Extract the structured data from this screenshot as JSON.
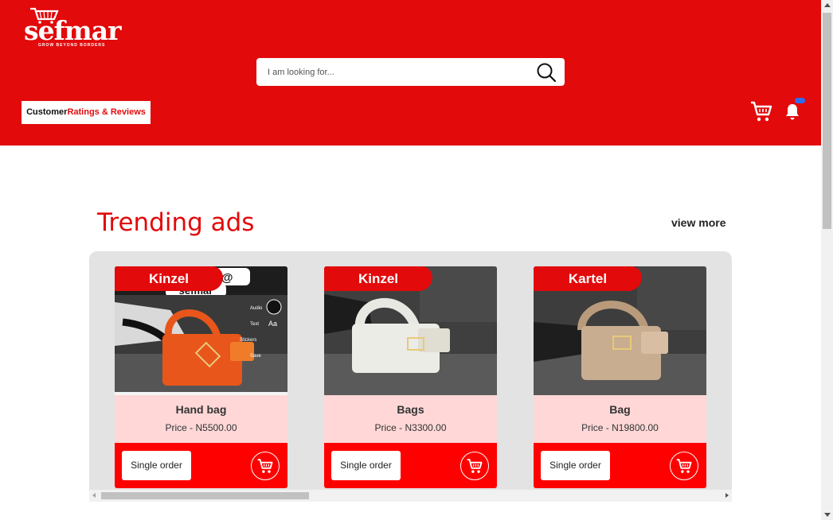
{
  "brand": {
    "name": "sefmar",
    "tagline": "GROW BEYOND BORDERS"
  },
  "search": {
    "placeholder": "I am looking for..."
  },
  "nav": {
    "reviews_part1": "Customer",
    "reviews_part2": "Ratings & Reviews"
  },
  "icons": {
    "cart": "cart-icon",
    "bell": "bell-icon",
    "search": "search-icon"
  },
  "colors": {
    "brand_red": "#e20a0b",
    "card_bg": "#ffd7d7",
    "card_footer": "#ff0000",
    "badge": "#2f6df6"
  },
  "trending": {
    "title": "Trending ads",
    "view_more": "view more",
    "items": [
      {
        "seller": "Kinzel",
        "name": "Hand bag",
        "price": "Price - N5500.00",
        "order_label": "Single order",
        "bag_color": "#e8561b"
      },
      {
        "seller": "Kinzel",
        "name": "Bags",
        "price": "Price - N3300.00",
        "order_label": "Single order",
        "bag_color": "#ecece6"
      },
      {
        "seller": "Kartel",
        "name": "Bag",
        "price": "Price - N19800.00",
        "order_label": "Single order",
        "bag_color": "#c9ad90"
      }
    ]
  },
  "story_overlay": {
    "text": "s @",
    "text2": "sefmar",
    "menu": [
      "Audio",
      "Text",
      "Stickers",
      "Save"
    ],
    "text_glyph": "Aa"
  }
}
